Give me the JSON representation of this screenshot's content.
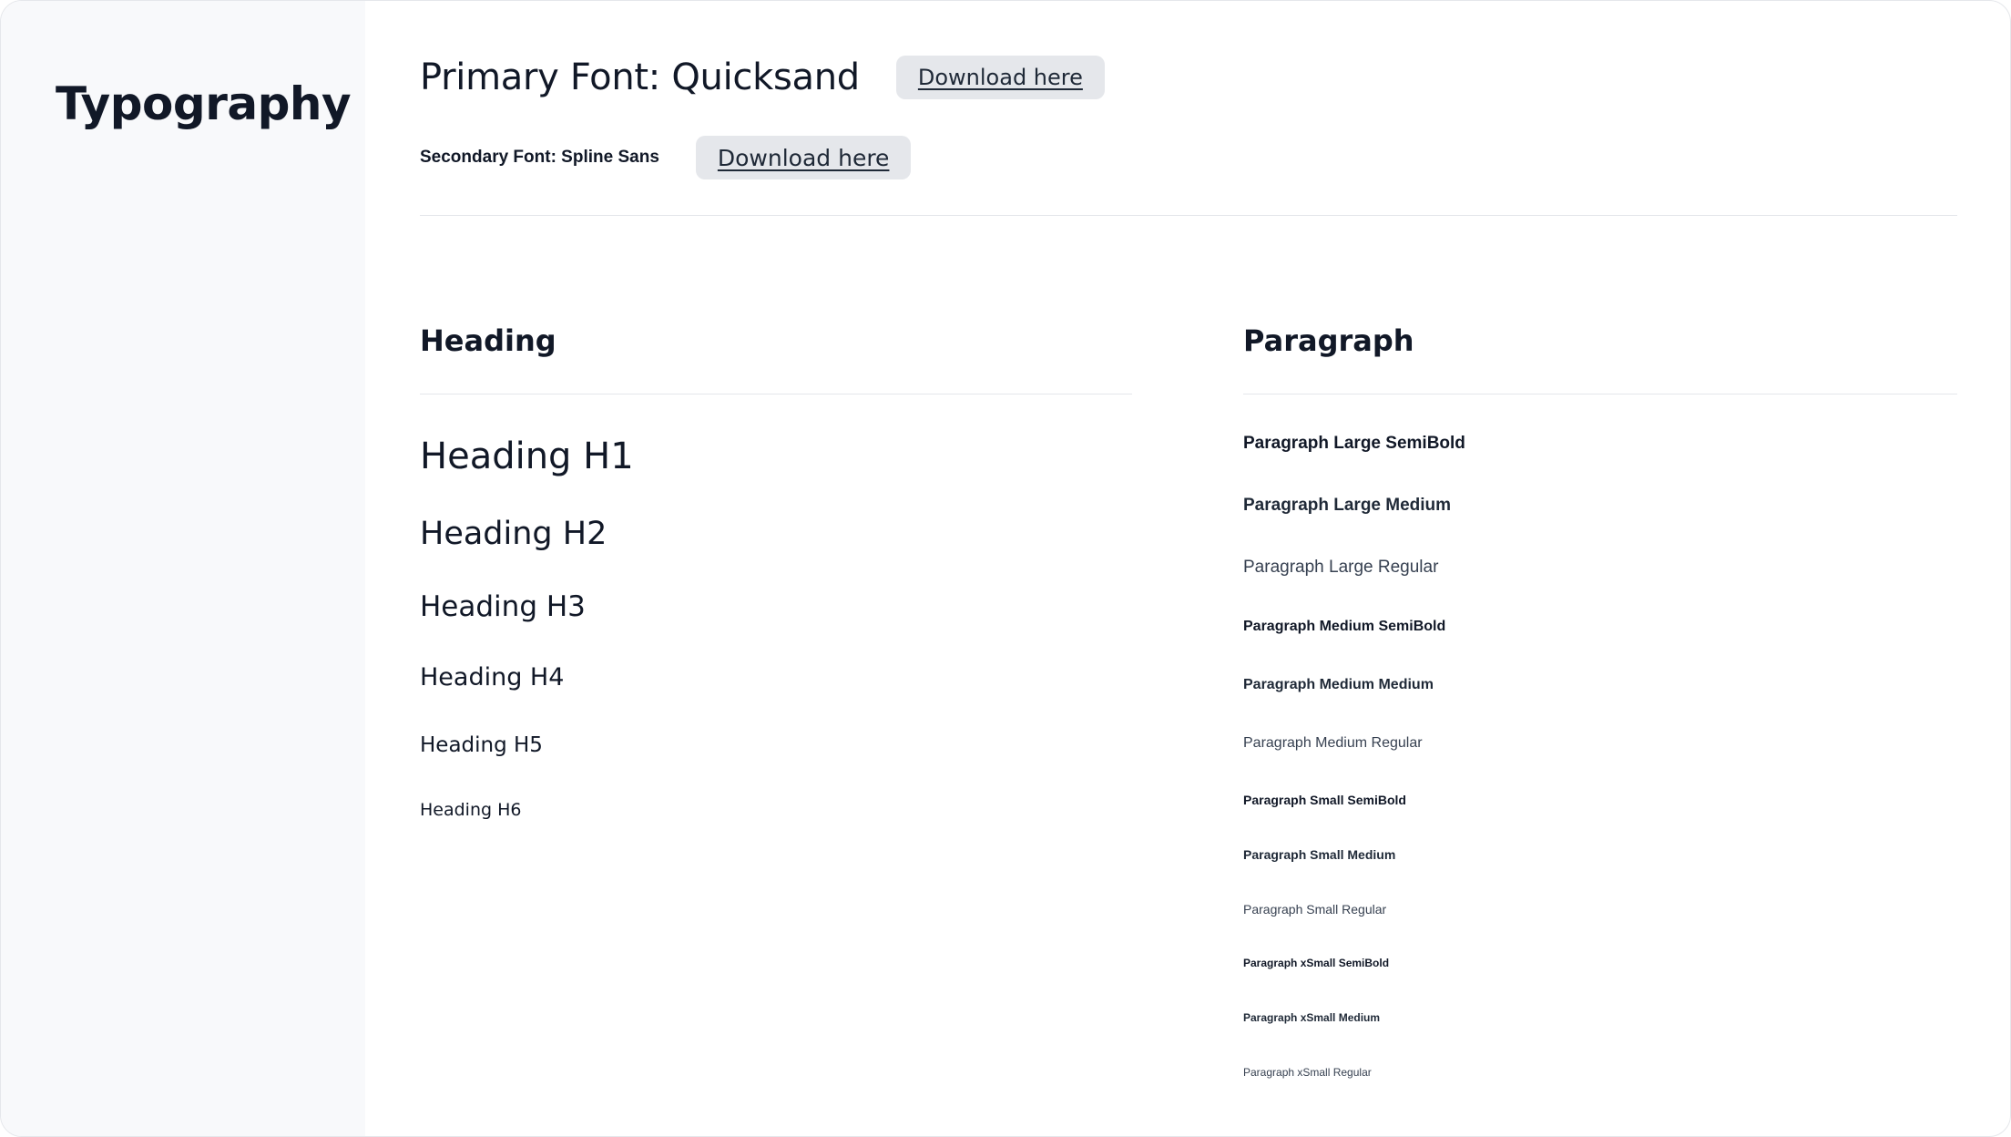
{
  "sidebar": {
    "title": "Typography"
  },
  "fonts": {
    "primary_label": "Primary Font: Quicksand",
    "primary_download": "Download here",
    "secondary_label": "Secondary Font: Spline Sans",
    "secondary_download": "Download here"
  },
  "heading_section": {
    "title": "Heading",
    "items": [
      "Heading H1",
      "Heading H2",
      "Heading H3",
      "Heading H4",
      "Heading H5",
      "Heading H6"
    ]
  },
  "paragraph_section": {
    "title": "Paragraph",
    "items": [
      "Paragraph Large SemiBold",
      "Paragraph Large Medium",
      "Paragraph Large Regular",
      "Paragraph Medium SemiBold",
      "Paragraph Medium Medium",
      "Paragraph Medium Regular",
      "Paragraph Small SemiBold",
      "Paragraph Small Medium",
      "Paragraph Small Regular",
      "Paragraph xSmall SemiBold",
      "Paragraph xSmall Medium",
      "Paragraph xSmall Regular"
    ]
  },
  "colors": {
    "text": "#111827",
    "sidebar_bg": "#f8f9fb",
    "button_bg": "#e5e7eb",
    "divider": "#e5e7eb"
  }
}
